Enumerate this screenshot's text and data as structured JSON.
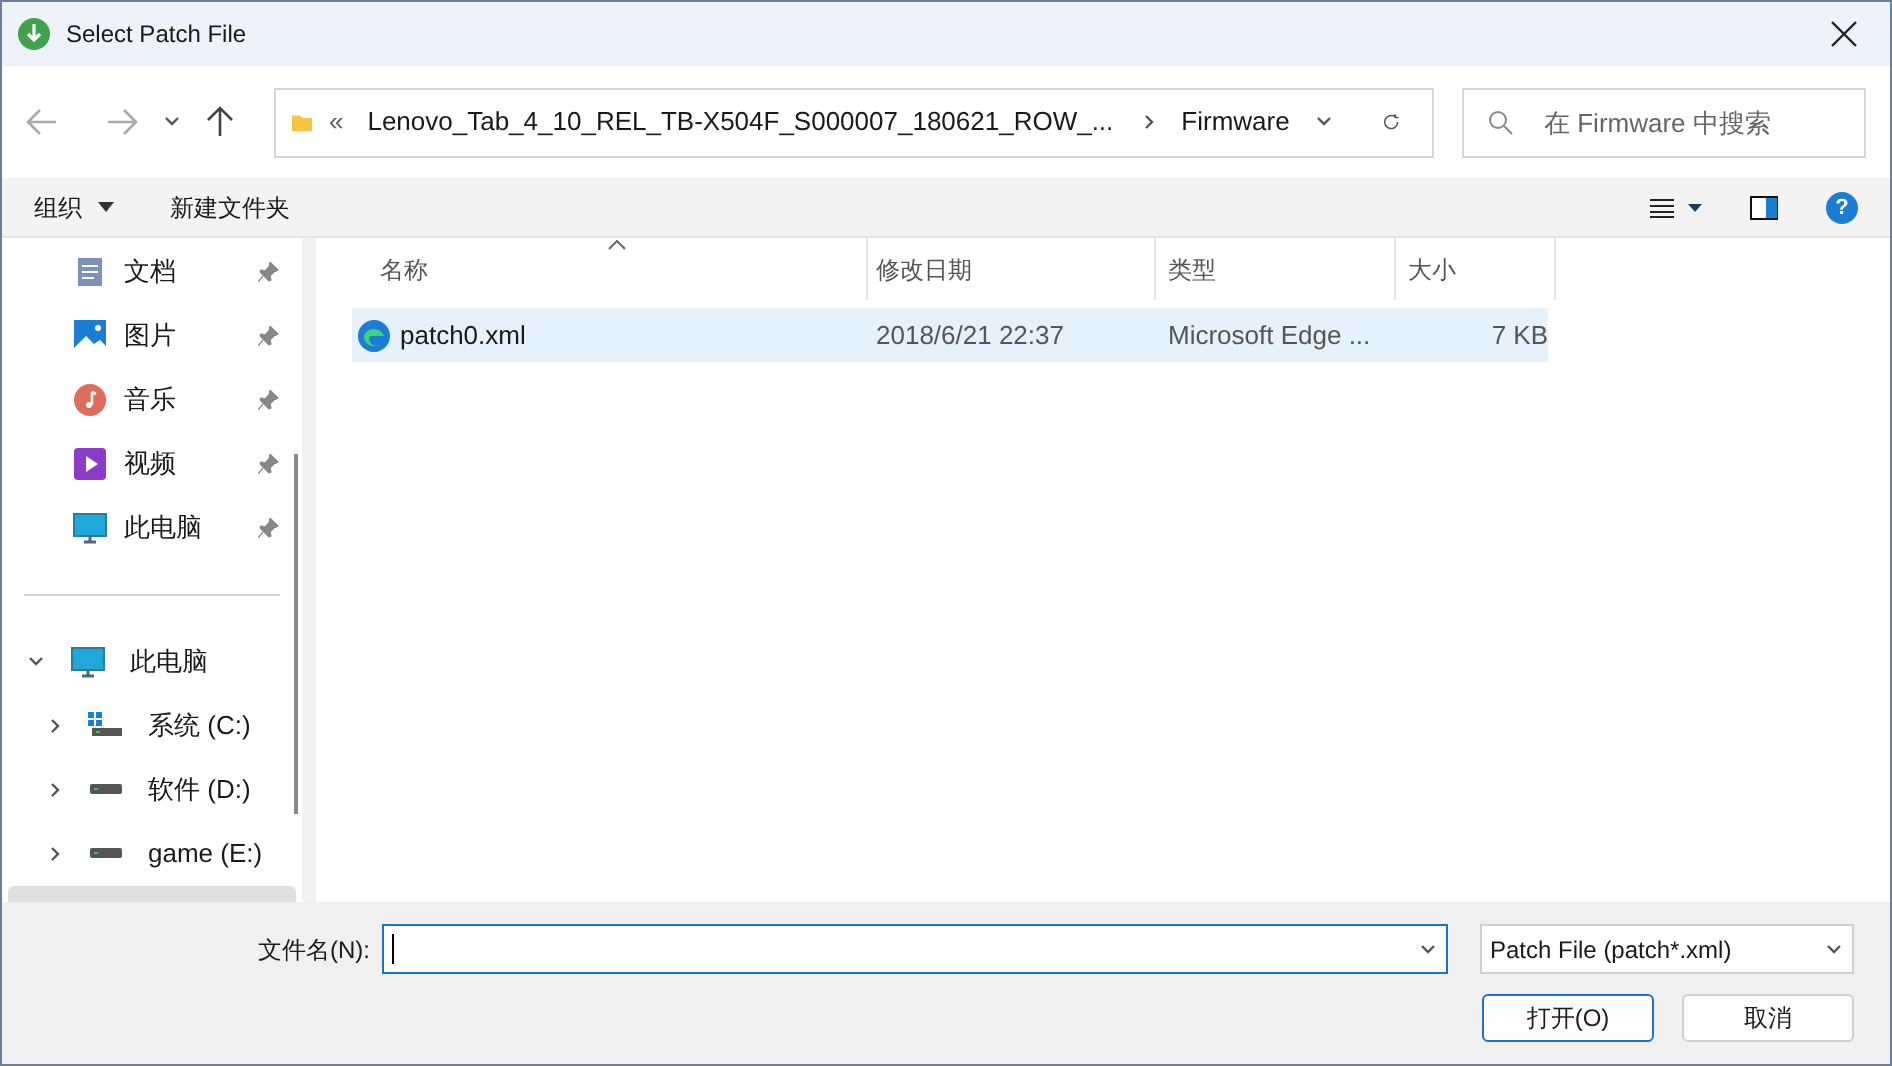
{
  "window": {
    "title": "Select Patch File"
  },
  "address": {
    "overflow": "«",
    "segments": [
      "Lenovo_Tab_4_10_REL_TB-X504F_S000007_180621_ROW_...",
      "Firmware"
    ]
  },
  "search": {
    "placeholder": "在 Firmware 中搜索"
  },
  "toolbar": {
    "organize": "组织",
    "new_folder": "新建文件夹",
    "help": "?"
  },
  "sidebar": {
    "quick_access": [
      {
        "label": "文档",
        "kind": "documents",
        "pinned": true
      },
      {
        "label": "图片",
        "kind": "pictures",
        "pinned": true
      },
      {
        "label": "音乐",
        "kind": "music",
        "pinned": true
      },
      {
        "label": "视频",
        "kind": "videos",
        "pinned": true
      },
      {
        "label": "此电脑",
        "kind": "computer",
        "pinned": true
      }
    ],
    "tree": [
      {
        "label": "此电脑",
        "kind": "computer",
        "expanded": true,
        "children": [
          {
            "label": "系统 (C:)",
            "kind": "system_drive",
            "expanded": false
          },
          {
            "label": "软件 (D:)",
            "kind": "drive",
            "expanded": false
          },
          {
            "label": "game (E:)",
            "kind": "drive",
            "expanded": false
          }
        ]
      }
    ]
  },
  "table": {
    "columns": [
      "名称",
      "修改日期",
      "类型",
      "大小"
    ],
    "rows": [
      {
        "name": "patch0.xml",
        "date": "2018/6/21 22:37",
        "type": "Microsoft Edge ...",
        "size": "7 KB",
        "selected": true
      }
    ]
  },
  "footer": {
    "filename_label": "文件名(N):",
    "file_type": "Patch File (patch*.xml)",
    "open": "打开(O)",
    "cancel": "取消"
  }
}
